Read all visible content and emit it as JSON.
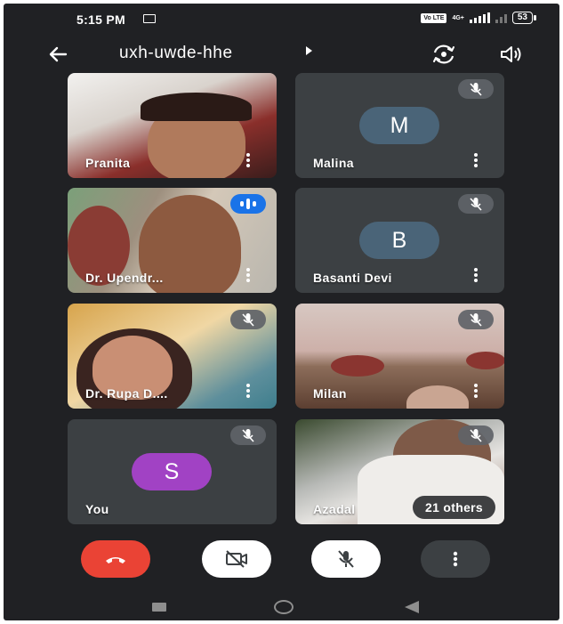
{
  "status_bar": {
    "time": "5:15 PM",
    "volte": "Vo LTE",
    "network": "4G+",
    "battery": "53"
  },
  "header": {
    "meeting_code": "uxh-uwde-hhe",
    "icons": [
      "back-arrow-icon",
      "switch-camera-icon",
      "speaker-icon"
    ]
  },
  "participants": [
    {
      "name": "Pranita",
      "video": true,
      "muted": false,
      "speaking": false
    },
    {
      "name": "Malina",
      "avatar": "M",
      "avatar_color": "#4a6478",
      "video": false,
      "muted": true
    },
    {
      "name": "Dr. Upendr...",
      "video": true,
      "muted": false,
      "speaking": true
    },
    {
      "name": "Basanti Devi",
      "avatar": "B",
      "avatar_color": "#4a6478",
      "video": false,
      "muted": true
    },
    {
      "name": "Dr. Rupa D....",
      "video": true,
      "muted": true
    },
    {
      "name": "Milan",
      "video": true,
      "muted": true
    },
    {
      "name": "You",
      "avatar": "S",
      "avatar_color": "#a142c4",
      "video": false,
      "muted": true
    },
    {
      "name": "Azadal",
      "video": true,
      "muted": true,
      "others_label": "21 others"
    }
  ],
  "controls": {
    "icons": [
      "end-call-icon",
      "camera-off-icon",
      "mic-off-icon",
      "more-options-icon"
    ],
    "colors": {
      "end_call": "#ea4335",
      "active": "#ffffff",
      "neutral": "#3c4043"
    }
  },
  "colors": {
    "background": "#202124",
    "tile": "#3c4043",
    "speaking": "#1a73e8"
  }
}
